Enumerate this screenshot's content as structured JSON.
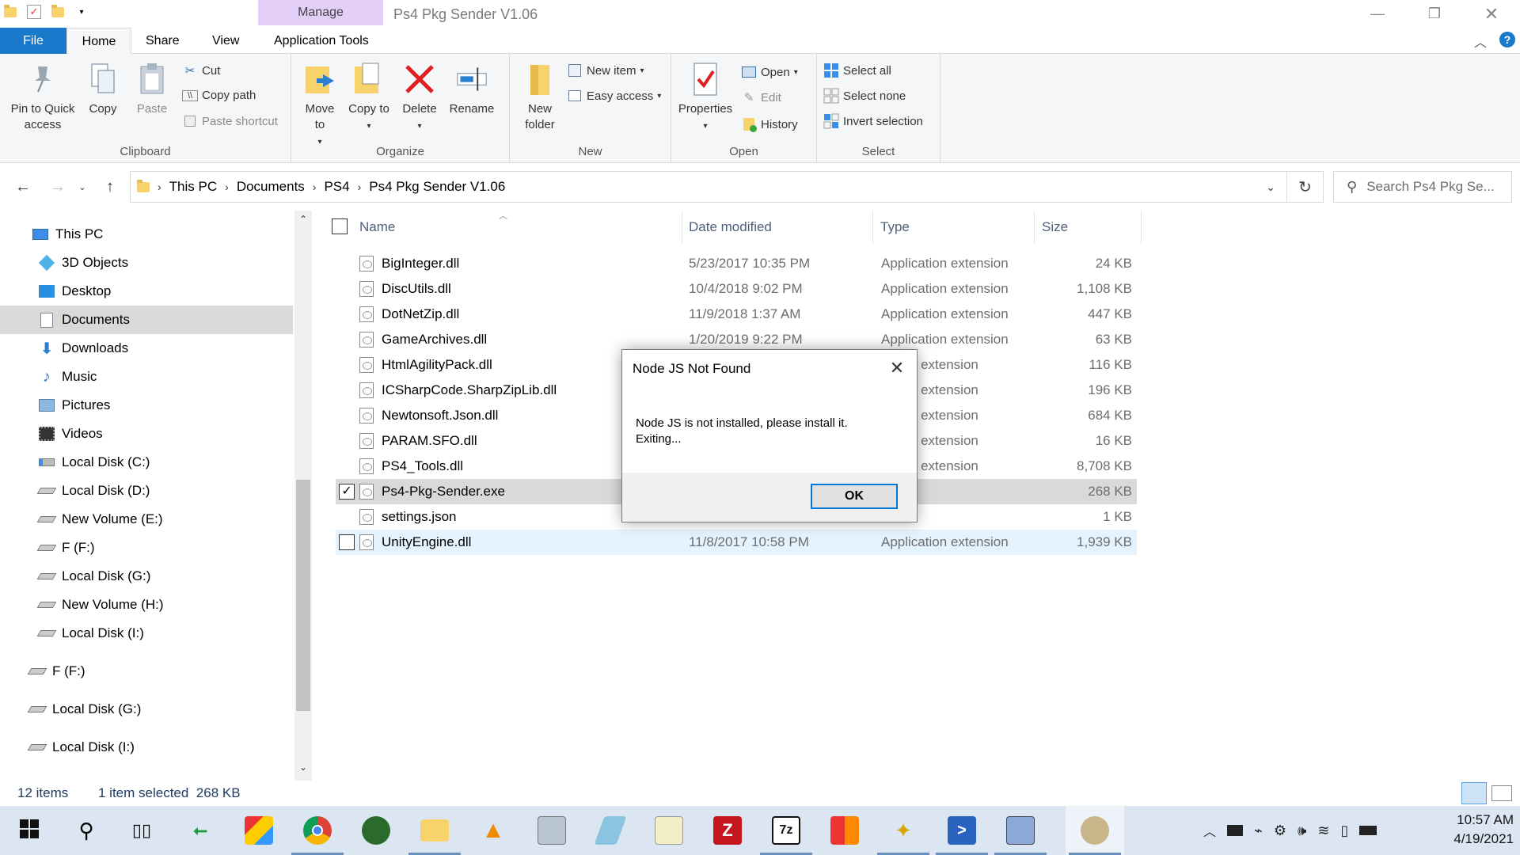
{
  "window": {
    "title": "Ps4 Pkg Sender V1.06",
    "manage_tab": "Manage"
  },
  "tabs": {
    "file": "File",
    "home": "Home",
    "share": "Share",
    "view": "View",
    "app_tools": "Application Tools"
  },
  "ribbon": {
    "clipboard": {
      "label": "Clipboard",
      "pin": "Pin to Quick access",
      "copy": "Copy",
      "paste": "Paste",
      "cut": "Cut",
      "copy_path": "Copy path",
      "paste_shortcut": "Paste shortcut"
    },
    "organize": {
      "label": "Organize",
      "move_to": "Move to",
      "copy_to": "Copy to",
      "delete": "Delete",
      "rename": "Rename"
    },
    "new": {
      "label": "New",
      "new_folder": "New folder",
      "new_item": "New item",
      "easy_access": "Easy access"
    },
    "open": {
      "label": "Open",
      "properties": "Properties",
      "open": "Open",
      "edit": "Edit",
      "history": "History"
    },
    "select": {
      "label": "Select",
      "select_all": "Select all",
      "select_none": "Select none",
      "invert": "Invert selection"
    }
  },
  "address": {
    "crumbs": [
      "This PC",
      "Documents",
      "PS4",
      "Ps4 Pkg Sender V1.06"
    ],
    "search_placeholder": "Search Ps4 Pkg Se..."
  },
  "nav": [
    {
      "label": "This PC",
      "icon": "pc-icon"
    },
    {
      "label": "3D Objects",
      "icon": "cube-icon"
    },
    {
      "label": "Desktop",
      "icon": "desktop-icon"
    },
    {
      "label": "Documents",
      "icon": "documents-icon"
    },
    {
      "label": "Downloads",
      "icon": "download-icon"
    },
    {
      "label": "Music",
      "icon": "music-icon"
    },
    {
      "label": "Pictures",
      "icon": "pictures-icon"
    },
    {
      "label": "Videos",
      "icon": "videos-icon"
    },
    {
      "label": "Local Disk (C:)",
      "icon": "drive-icon"
    },
    {
      "label": "Local Disk (D:)",
      "icon": "drive-icon"
    },
    {
      "label": "New Volume (E:)",
      "icon": "drive-icon"
    },
    {
      "label": "F (F:)",
      "icon": "drive-icon"
    },
    {
      "label": "Local Disk (G:)",
      "icon": "drive-icon"
    },
    {
      "label": "New Volume (H:)",
      "icon": "drive-icon"
    },
    {
      "label": "Local Disk (I:)",
      "icon": "drive-icon"
    },
    {
      "label": "F (F:)",
      "icon": "drive-icon"
    },
    {
      "label": "Local Disk (G:)",
      "icon": "drive-icon"
    },
    {
      "label": "Local Disk (I:)",
      "icon": "drive-icon"
    }
  ],
  "columns": {
    "name": "Name",
    "date": "Date modified",
    "type": "Type",
    "size": "Size"
  },
  "files": [
    {
      "name": "BigInteger.dll",
      "date": "5/23/2017 10:35 PM",
      "type": "Application extension",
      "size": "24 KB"
    },
    {
      "name": "DiscUtils.dll",
      "date": "10/4/2018 9:02 PM",
      "type": "Application extension",
      "size": "1,108 KB"
    },
    {
      "name": "DotNetZip.dll",
      "date": "11/9/2018 1:37 AM",
      "type": "Application extension",
      "size": "447 KB"
    },
    {
      "name": "GameArchives.dll",
      "date": "1/20/2019 9:22 PM",
      "type": "Application extension",
      "size": "63 KB"
    },
    {
      "name": "HtmlAgilityPack.dll",
      "date": "",
      "type": "cation extension",
      "size": "116 KB"
    },
    {
      "name": "ICSharpCode.SharpZipLib.dll",
      "date": "",
      "type": "cation extension",
      "size": "196 KB"
    },
    {
      "name": "Newtonsoft.Json.dll",
      "date": "",
      "type": "cation extension",
      "size": "684 KB"
    },
    {
      "name": "PARAM.SFO.dll",
      "date": "",
      "type": "cation extension",
      "size": "16 KB"
    },
    {
      "name": "PS4_Tools.dll",
      "date": "",
      "type": "cation extension",
      "size": "8,708 KB"
    },
    {
      "name": "Ps4-Pkg-Sender.exe",
      "date": "",
      "type": "cation",
      "size": "268 KB"
    },
    {
      "name": "settings.json",
      "date": "",
      "type": "File",
      "size": "1 KB"
    },
    {
      "name": "UnityEngine.dll",
      "date": "11/8/2017 10:58 PM",
      "type": "Application extension",
      "size": "1,939 KB"
    }
  ],
  "status": {
    "count": "12 items",
    "selected": "1 item selected  268 KB"
  },
  "dialog": {
    "title": "Node JS Not Found",
    "message_line1": "Node JS is not installed, please install it.",
    "message_line2": "Exiting...",
    "ok": "OK"
  },
  "clock": {
    "time": "10:57 AM",
    "date": "4/19/2021"
  },
  "colors": {
    "file_tab": "#1979ca",
    "manage_tab": "#e3cef8",
    "selection": "#d9d9d9",
    "taskbar": "#dce6f2"
  }
}
